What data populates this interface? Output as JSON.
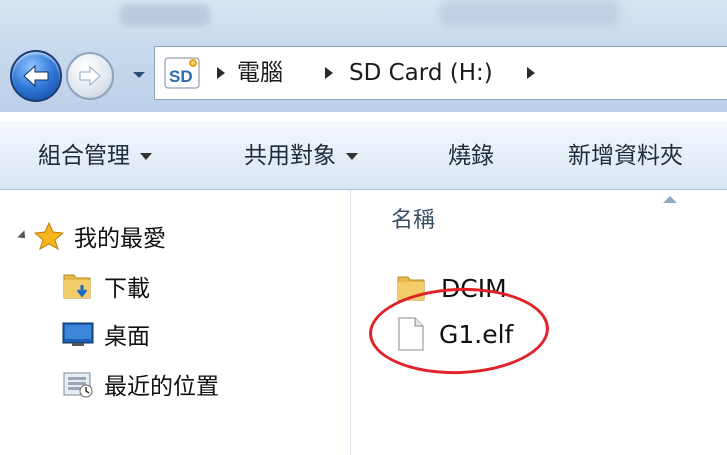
{
  "address_bar": {
    "crumbs": [
      "電腦",
      "SD Card (H:)"
    ]
  },
  "commands": {
    "organize": "組合管理",
    "share_with": "共用對象",
    "burn": "燒錄",
    "new_folder": "新增資料夾"
  },
  "nav_pane": {
    "favorites_label": "我的最愛",
    "items": [
      {
        "label": "下載",
        "icon": "downloads-folder-icon"
      },
      {
        "label": "桌面",
        "icon": "desktop-icon"
      },
      {
        "label": "最近的位置",
        "icon": "recent-places-icon"
      }
    ]
  },
  "content": {
    "column_header": "名稱",
    "files": [
      {
        "name": "DCIM",
        "icon": "folder-icon"
      },
      {
        "name": "G1.elf",
        "icon": "file-icon"
      }
    ],
    "highlight_color": "#e0222a"
  }
}
